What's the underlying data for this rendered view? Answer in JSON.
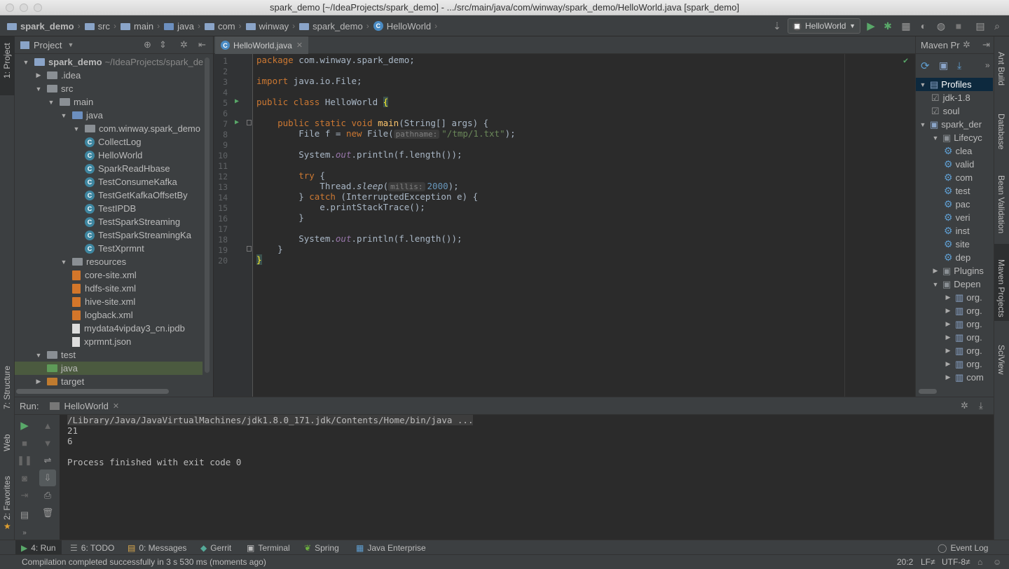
{
  "window": {
    "title": "spark_demo [~/IdeaProjects/spark_demo] - .../src/main/java/com/winway/spark_demo/HelloWorld.java [spark_demo]"
  },
  "breadcrumbs": [
    "spark_demo",
    "src",
    "main",
    "java",
    "com",
    "winway",
    "spark_demo",
    "HelloWorld"
  ],
  "run_config": {
    "selected": "HelloWorld"
  },
  "left_stripe": {
    "project": "1: Project",
    "structure": "7: Structure",
    "web": "Web",
    "favorites": "2: Favorites"
  },
  "right_stripe": {
    "ant": "Ant Build",
    "database": "Database",
    "bean": "Bean Validation",
    "maven": "Maven Projects",
    "sciview": "SciView"
  },
  "project": {
    "title": "Project",
    "tree": [
      {
        "label": "spark_demo",
        "extra": "~/IdeaProjects/spark_de",
        "kind": "module",
        "arrow": "open"
      },
      {
        "label": ".idea",
        "kind": "folder",
        "arrow": "closed"
      },
      {
        "label": "src",
        "kind": "folder",
        "arrow": "open"
      },
      {
        "label": "main",
        "kind": "folder",
        "arrow": "open"
      },
      {
        "label": "java",
        "kind": "src",
        "arrow": "open"
      },
      {
        "label": "com.winway.spark_demo",
        "kind": "package",
        "arrow": "open"
      },
      {
        "label": "CollectLog",
        "kind": "class"
      },
      {
        "label": "HelloWorld",
        "kind": "class"
      },
      {
        "label": "SparkReadHbase",
        "kind": "class"
      },
      {
        "label": "TestConsumeKafka",
        "kind": "class"
      },
      {
        "label": "TestGetKafkaOffsetBy",
        "kind": "class"
      },
      {
        "label": "TestIPDB",
        "kind": "class"
      },
      {
        "label": "TestSparkStreaming",
        "kind": "class"
      },
      {
        "label": "TestSparkStreamingKa",
        "kind": "class"
      },
      {
        "label": "TestXprmnt",
        "kind": "class"
      },
      {
        "label": "resources",
        "kind": "resources",
        "arrow": "open"
      },
      {
        "label": "core-site.xml",
        "kind": "xml"
      },
      {
        "label": "hdfs-site.xml",
        "kind": "xml"
      },
      {
        "label": "hive-site.xml",
        "kind": "xml"
      },
      {
        "label": "logback.xml",
        "kind": "xml"
      },
      {
        "label": "mydata4vipday3_cn.ipdb",
        "kind": "file"
      },
      {
        "label": "xprmnt.json",
        "kind": "file"
      },
      {
        "label": "test",
        "kind": "folder",
        "arrow": "open"
      },
      {
        "label": "java",
        "kind": "testsrc"
      },
      {
        "label": "target",
        "kind": "target",
        "arrow": "closed"
      }
    ]
  },
  "editor": {
    "tab": "HelloWorld.java",
    "line_numbers": [
      "1",
      "2",
      "3",
      "4",
      "5",
      "6",
      "7",
      "8",
      "9",
      "10",
      "11",
      "12",
      "13",
      "14",
      "15",
      "16",
      "17",
      "18",
      "19",
      "20"
    ],
    "code": {
      "l1a": "package",
      "l1b": " com.winway.spark_demo;",
      "l3a": "import",
      "l3b": " java.io.File;",
      "l5a": "public class",
      "l5b": " HelloWorld ",
      "l5c": "{",
      "l7a": "    public static void",
      "l7b": " main",
      "l7c": "(String[] args) {",
      "l8a": "        File f = ",
      "l8b": "new",
      "l8c": " File(",
      "l8hint": "pathname:",
      "l8str": "\"/tmp/1.txt\"",
      "l8d": ");",
      "l10a": "        System.",
      "l10b": "out",
      "l10c": ".println(f.length());",
      "l12a": "        try",
      "l12b": " {",
      "l13a": "            Thread.",
      "l13b": "sleep",
      "l13c": "(",
      "l13hint": "millis:",
      "l13num": "2000",
      "l13d": ");",
      "l14a": "        } ",
      "l14b": "catch",
      "l14c": " (InterruptedException e) {",
      "l15": "            e.printStackTrace();",
      "l16": "        }",
      "l18a": "        System.",
      "l18b": "out",
      "l18c": ".println(f.length());",
      "l19": "    }",
      "l20": "}"
    }
  },
  "maven": {
    "title": "Maven Pr",
    "items": [
      {
        "label": "Profiles",
        "arrow": "open"
      },
      {
        "label": "jdk-1.8",
        "check": true
      },
      {
        "label": "soul",
        "check": true
      },
      {
        "label": "spark_der",
        "arrow": "open"
      },
      {
        "label": "Lifecyc",
        "arrow": "open"
      },
      {
        "label": "clea"
      },
      {
        "label": "valid"
      },
      {
        "label": "com"
      },
      {
        "label": "test"
      },
      {
        "label": "pac"
      },
      {
        "label": "veri"
      },
      {
        "label": "inst"
      },
      {
        "label": "site"
      },
      {
        "label": "dep"
      },
      {
        "label": "Plugins",
        "arrow": "closed"
      },
      {
        "label": "Depen",
        "arrow": "open"
      },
      {
        "label": "org."
      },
      {
        "label": "org."
      },
      {
        "label": "org."
      },
      {
        "label": "org."
      },
      {
        "label": "org."
      },
      {
        "label": "org."
      },
      {
        "label": "com"
      }
    ]
  },
  "run": {
    "label": "Run:",
    "tab": "HelloWorld",
    "console": [
      "/Library/Java/JavaVirtualMachines/jdk1.8.0_171.jdk/Contents/Home/bin/java ...",
      "21",
      "6",
      "",
      "Process finished with exit code 0"
    ]
  },
  "bottom_tools": [
    {
      "label": "4: Run"
    },
    {
      "label": "6: TODO"
    },
    {
      "label": "0: Messages"
    },
    {
      "label": "Gerrit"
    },
    {
      "label": "Terminal"
    },
    {
      "label": "Spring"
    },
    {
      "label": "Java Enterprise"
    }
  ],
  "event_log": "Event Log",
  "status": {
    "message": "Compilation completed successfully in 3 s 530 ms (moments ago)",
    "position": "20:2",
    "line_sep": "LF≠",
    "encoding": "UTF-8≠"
  }
}
